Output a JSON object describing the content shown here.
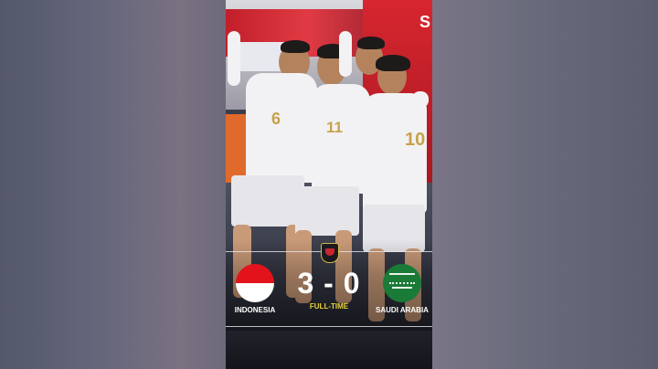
{
  "match": {
    "home_team": "INDONESIA",
    "away_team": "SAUDI ARABIA",
    "score_home": "3",
    "score_separator": "-",
    "score_away": "0",
    "status": "FULL-TIME"
  },
  "jersey_numbers": [
    "6",
    "11",
    "10"
  ],
  "banner_text": "S",
  "colors": {
    "status": "#e8d23a",
    "indonesia_red": "#e3131c",
    "saudi_green": "#1a7a37",
    "banner_red": "#d7262f"
  }
}
